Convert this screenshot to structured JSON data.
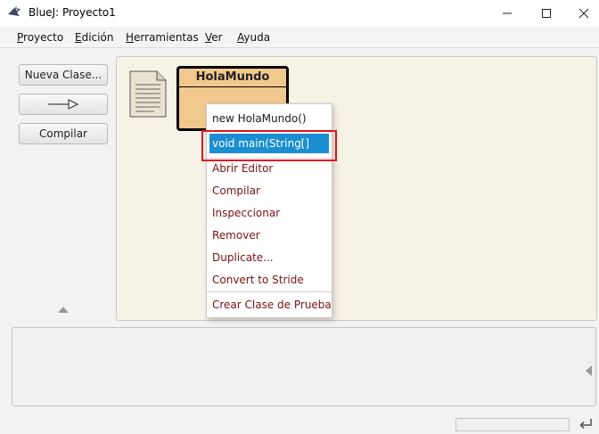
{
  "window": {
    "title": "BlueJ: Proyecto1"
  },
  "menubar": {
    "items": [
      {
        "label_ul": "P",
        "label_rest": "royecto"
      },
      {
        "label_ul": "E",
        "label_rest": "dición"
      },
      {
        "label_ul": "H",
        "label_rest": "erramientas"
      },
      {
        "label_ul": "V",
        "label_rest": "er"
      },
      {
        "label_ul": "A",
        "label_rest": "yuda"
      }
    ]
  },
  "toolbar": {
    "new_class_label": "Nueva Clase...",
    "compile_label": "Compilar"
  },
  "diagram": {
    "class_name": "HolaMundo"
  },
  "context_menu": {
    "items": [
      "new HolaMundo()",
      "void main(String[] args)",
      "Abrir Editor",
      "Compilar",
      "Inspeccionar",
      "Remover",
      "Duplicate...",
      "Convert to Stride",
      "Crear Clase de Prueba"
    ],
    "selected": "void main(String[] args)"
  },
  "colors": {
    "class_fill": "#f1c98e",
    "selection": "#1b8ed1",
    "highlight_frame": "#e0131e",
    "menu_text": "#7a1111"
  }
}
